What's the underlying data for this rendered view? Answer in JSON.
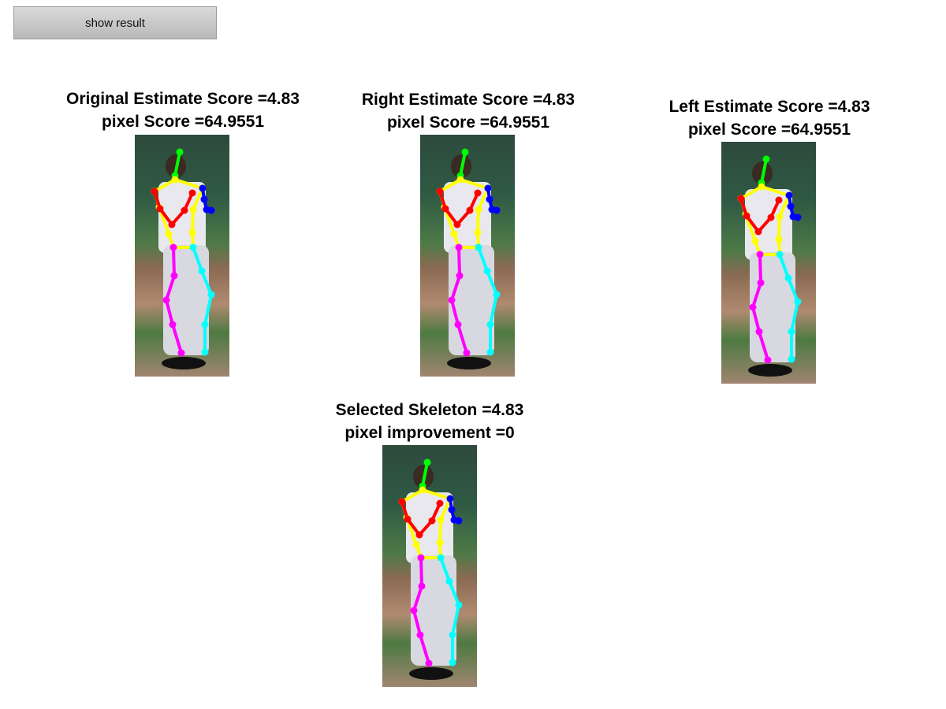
{
  "toolbar": {
    "show_result_label": "show result"
  },
  "panels": [
    {
      "id": "original",
      "title_line1": "Original Estimate Score =4.83",
      "title_line2": "pixel Score =64.9551"
    },
    {
      "id": "right",
      "title_line1": "Right Estimate Score =4.83",
      "title_line2": "pixel Score =64.9551"
    },
    {
      "id": "left",
      "title_line1": "Left Estimate Score =4.83",
      "title_line2": "pixel Score =64.9551"
    },
    {
      "id": "selected",
      "title_line1": "Selected Skeleton =4.83",
      "title_line2": "pixel improvement =0"
    }
  ],
  "skeleton_colors": {
    "head": "#00ff00",
    "torso": "#ffff00",
    "right_arm": "#ff0000",
    "left_arm": "#0000ff",
    "right_leg": "#ff00ff",
    "left_leg": "#00ffff"
  }
}
